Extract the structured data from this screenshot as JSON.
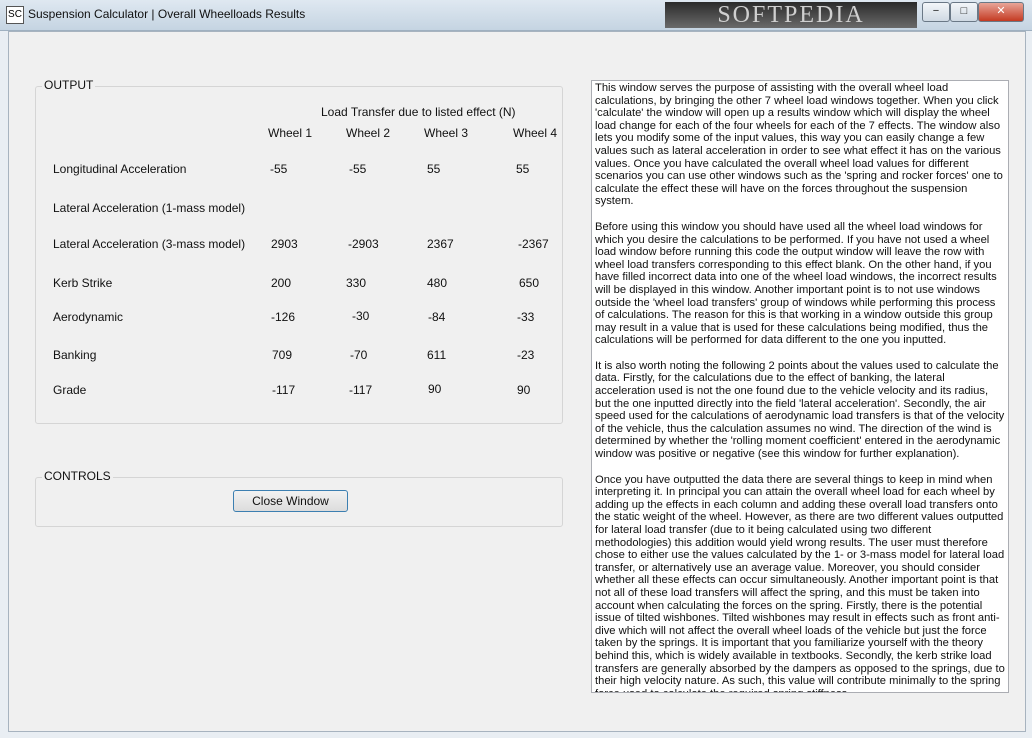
{
  "window": {
    "title": "Suspension Calculator | Overall Wheelloads Results",
    "icon_label": "SC",
    "watermark": "SOFTPEDIA",
    "controls": {
      "minimize": "−",
      "maximize": "□",
      "close": "✕"
    }
  },
  "output": {
    "legend": "OUTPUT",
    "heading": "Load Transfer due to listed effect (N)",
    "columns": [
      "Wheel 1",
      "Wheel 2",
      "Wheel 3",
      "Wheel 4"
    ],
    "rows": [
      {
        "label": "Longitudinal Acceleration",
        "values": [
          "-55",
          "-55",
          "55",
          "55"
        ]
      },
      {
        "label": "Lateral Acceleration (1-mass model)",
        "values": [
          "",
          "",
          "",
          ""
        ]
      },
      {
        "label": "Lateral Acceleration (3-mass model)",
        "values": [
          "2903",
          "-2903",
          "2367",
          "-2367"
        ]
      },
      {
        "label": "Kerb Strike",
        "values": [
          "200",
          "330",
          "480",
          "650"
        ]
      },
      {
        "label": "Aerodynamic",
        "values": [
          "-126",
          "-30",
          "-84",
          "-33"
        ]
      },
      {
        "label": "Banking",
        "values": [
          "709",
          "-70",
          "611",
          "-23"
        ]
      },
      {
        "label": "Grade",
        "values": [
          "-117",
          "-117",
          "90",
          "90"
        ]
      }
    ]
  },
  "controls": {
    "legend": "CONTROLS",
    "close_button": "Close Window"
  },
  "help_text": [
    "This window serves the purpose of assisting with the overall wheel load calculations, by bringing the other 7 wheel load windows together. When you click 'calculate' the window will open up a results window which will display the wheel load change for each of the four wheels for each of the 7 effects. The window also lets you modify some of the input values, this way you can easily change a few values such as lateral acceleration in order to see what effect it has on the various values. Once you have calculated the overall wheel load values for different scenarios you can use other windows such as the 'spring and rocker forces' one to calculate the effect these will have on the forces throughout the suspension system.",
    "Before using this window you should have used all the wheel load windows for which you desire the calculations to be performed. If you have not used a wheel load window before running this code the output window will leave the row with wheel load transfers corresponding to this effect blank. On the other hand, if you have filled incorrect data into one of the wheel load windows, the incorrect results will be displayed in this window. Another important point is to not use windows outside the 'wheel load transfers' group of windows while performing this process of calculations. The reason for this is that working in a window outside this group may result in a value that is used for these calculations being modified, thus the calculations will be performed for data different to the one you inputted.",
    "It is also worth noting the following 2 points about the values used to calculate the data. Firstly, for the calculations due to the effect of banking, the lateral acceleration used is not the one found due to the vehicle velocity and its radius, but the one inputted directly into the field 'lateral acceleration'. Secondly, the air speed used for the calculations of aerodynamic load transfers is that of the velocity of the vehicle, thus the calculation assumes no wind. The direction of the wind is determined by whether the 'rolling moment coefficient' entered in the aerodynamic window was positive or negative (see this window for further explanation).",
    "Once you have outputted the data there are several things to keep in mind when interpreting it. In principal you can attain the overall wheel load for each wheel by adding up the effects in each column and adding these overall load transfers onto the static weight of the wheel. However, as there are two different values outputted for lateral load transfer (due to it being calculated using two different methodologies) this addition would yield wrong results. The user must therefore chose to either use the values calculated by the 1- or 3-mass model for lateral load transfer, or alternatively use an average value. Moreover, you should consider whether all these effects can occur simultaneously. Another important point is that not all of these load transfers will affect the spring, and this must be taken into account when calculating the forces on the spring. Firstly, there is the potential issue of tilted wishbones. Tilted wishbones may result in effects such as front anti-dive which will not affect the overall wheel loads of the vehicle but just the force taken by the springs. It is important that you familiarize yourself with the theory behind this, which is widely available in textbooks. Secondly, the kerb strike load transfers are generally absorbed by the dampers as opposed to the springs, due to their high velocity nature. As such, this value will contribute minimally to the spring force used to calculate the required spring stiffness."
  ]
}
